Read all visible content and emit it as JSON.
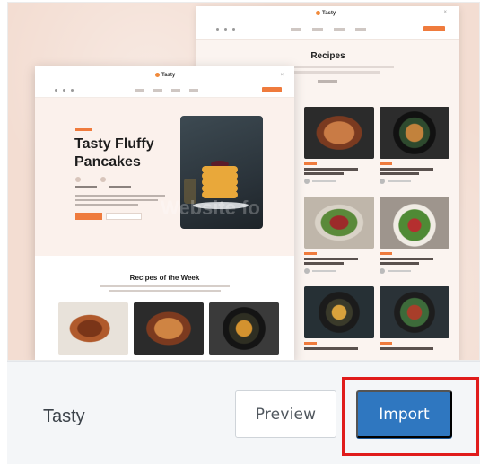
{
  "theme": {
    "name": "Tasty",
    "preview_label": "Preview",
    "import_label": "Import"
  },
  "thumbnail": {
    "back_page": {
      "logo": "Tasty",
      "close": "×",
      "section_title": "Recipes"
    },
    "front_page": {
      "logo": "Tasty",
      "close": "×",
      "hero_title": "Tasty Fluffy Pancakes",
      "section_title": "Recipes of the Week",
      "watermark": "Website fo"
    }
  },
  "colors": {
    "accent": "#ef7b3d",
    "import_button": "#2f77c0",
    "highlight_box": "#e01b1b"
  }
}
